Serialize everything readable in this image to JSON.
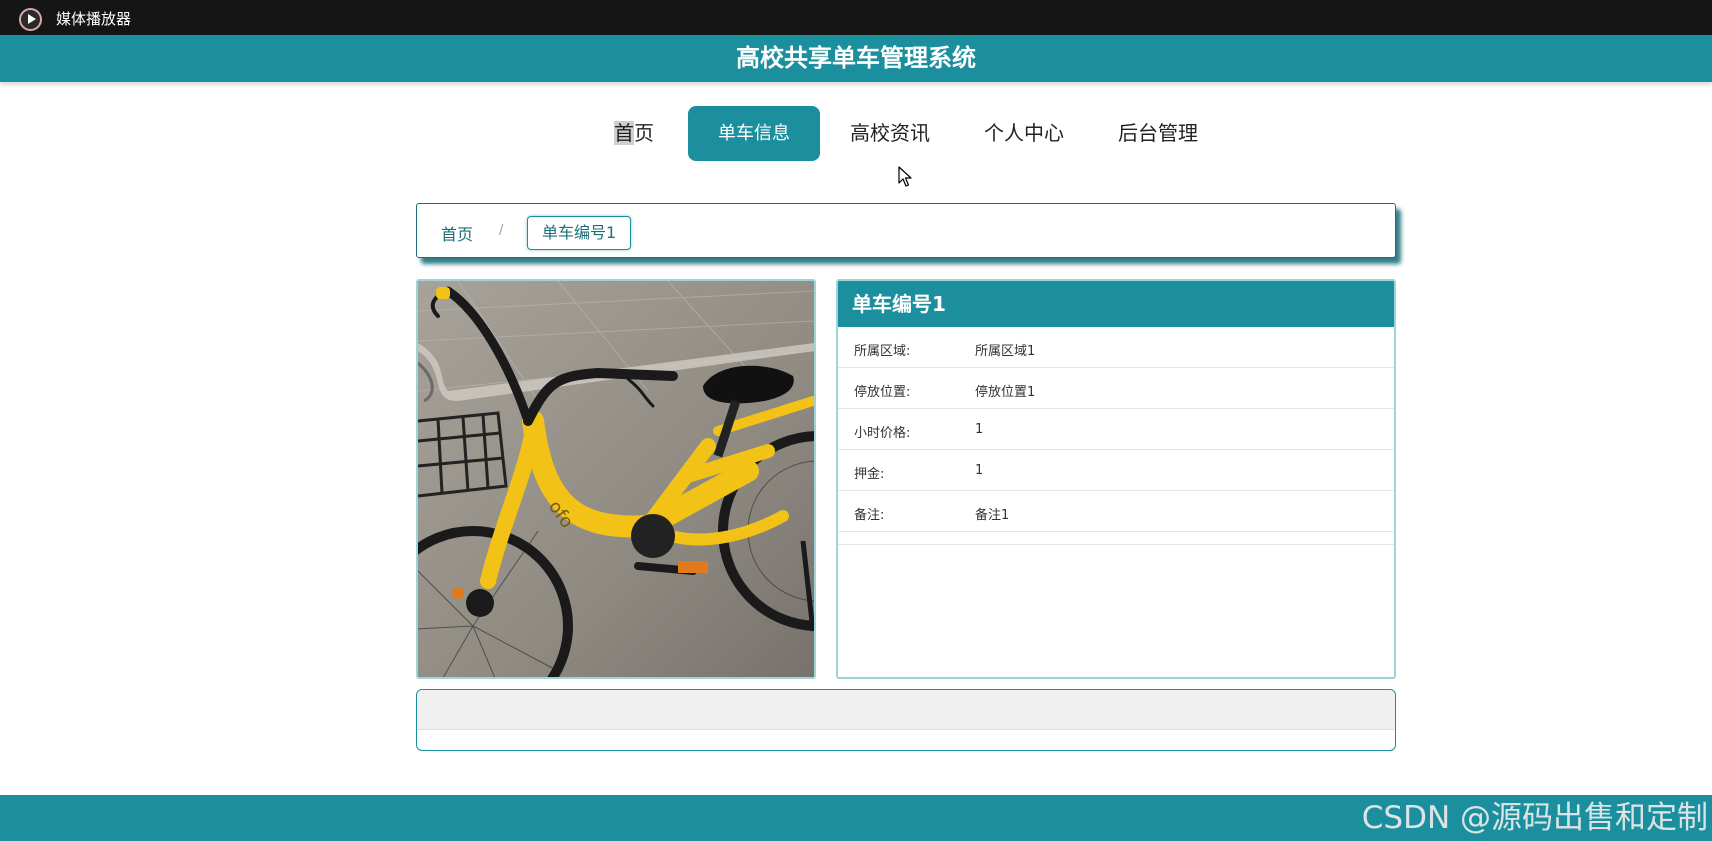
{
  "player": {
    "title": "媒体播放器",
    "icon": "play-circle-icon"
  },
  "site": {
    "title": "高校共享单车管理系统",
    "accent_color": "#1c8f9e"
  },
  "nav": {
    "items": [
      {
        "label_highlight": "首",
        "label_rest": "页"
      },
      {
        "label": "单车信息",
        "active": true
      },
      {
        "label": "高校资讯"
      },
      {
        "label": "个人中心"
      },
      {
        "label": "后台管理"
      }
    ]
  },
  "breadcrumb": {
    "home": "首页",
    "separator": "/",
    "current": "单车编号1"
  },
  "bike": {
    "name": "单车编号1",
    "fields": [
      {
        "label": "所属区域:",
        "value": "所属区域1"
      },
      {
        "label": "停放位置:",
        "value": "停放位置1"
      },
      {
        "label": "小时价格:",
        "value": "1"
      },
      {
        "label": "押金:",
        "value": "1"
      },
      {
        "label": "备注:",
        "value": "备注1"
      }
    ],
    "image_frame_logo": "ofo"
  },
  "watermark": "CSDN @源码出售和定制"
}
